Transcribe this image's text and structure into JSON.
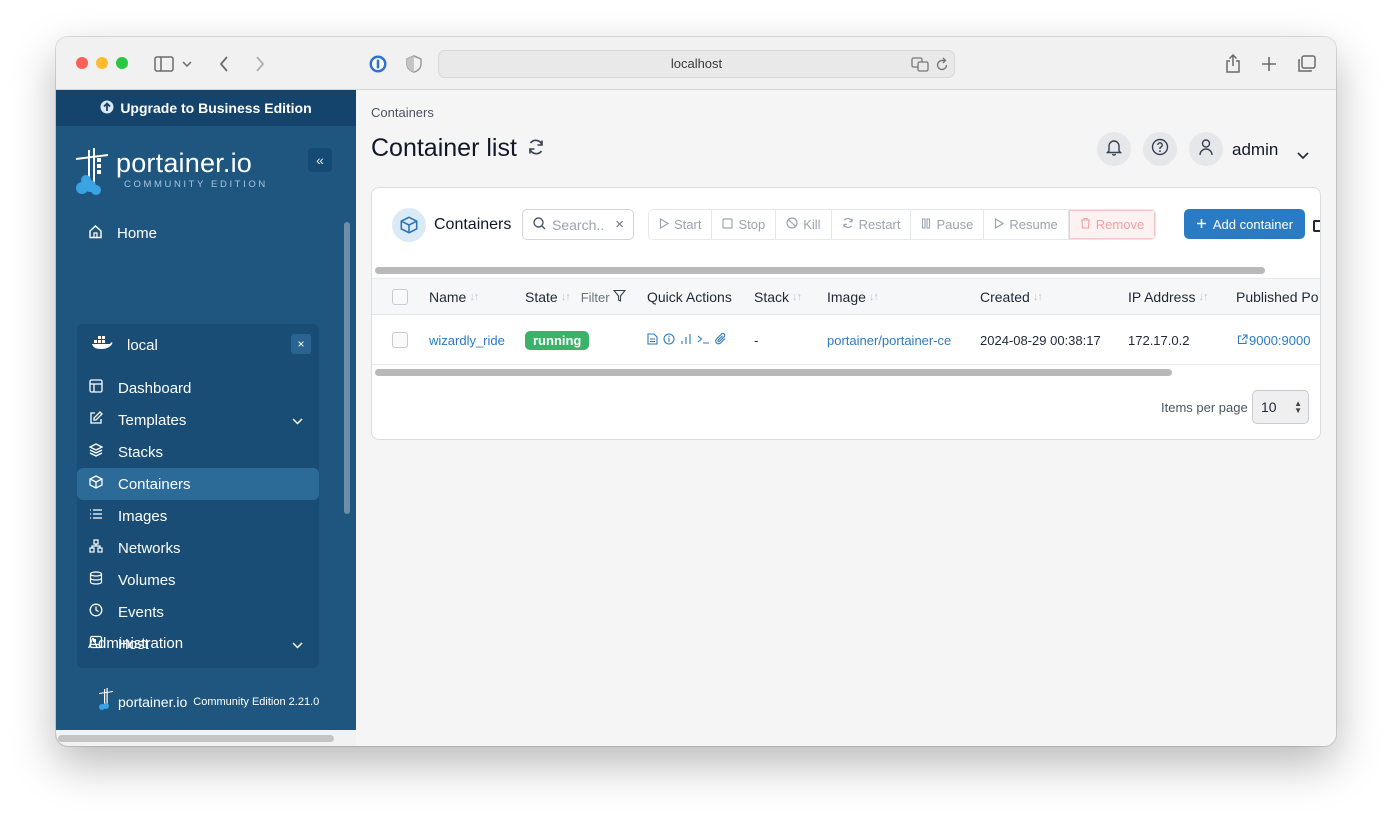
{
  "browser": {
    "url": "localhost"
  },
  "sidebar": {
    "upgrade_label": "Upgrade to Business Edition",
    "logo_word": "portainer.io",
    "logo_sub": "COMMUNITY EDITION",
    "collapse_label": "«",
    "home_label": "Home",
    "environment": {
      "name": "local",
      "close_label": "×",
      "items": [
        {
          "label": "Dashboard",
          "icon": "dashboard-icon"
        },
        {
          "label": "Templates",
          "icon": "edit-icon"
        },
        {
          "label": "Stacks",
          "icon": "layers-icon"
        },
        {
          "label": "Containers",
          "icon": "box-icon"
        },
        {
          "label": "Images",
          "icon": "list-icon"
        },
        {
          "label": "Networks",
          "icon": "network-icon"
        },
        {
          "label": "Volumes",
          "icon": "database-icon"
        },
        {
          "label": "Events",
          "icon": "clock-icon"
        },
        {
          "label": "Host",
          "icon": "host-icon"
        }
      ]
    },
    "administration_label": "Administration",
    "footer": {
      "brand": "portainer.io",
      "edition": "Community Edition 2.21.0"
    }
  },
  "header": {
    "breadcrumb": "Containers",
    "title": "Container list",
    "user": "admin"
  },
  "containers_card": {
    "title": "Containers",
    "search_placeholder": "Search..",
    "actions": {
      "start": "Start",
      "stop": "Stop",
      "kill": "Kill",
      "restart": "Restart",
      "pause": "Pause",
      "resume": "Resume",
      "remove": "Remove",
      "add": "Add container"
    },
    "columns": {
      "name": "Name",
      "state": "State",
      "filter": "Filter",
      "quick_actions": "Quick Actions",
      "stack": "Stack",
      "image": "Image",
      "created": "Created",
      "ip": "IP Address",
      "published": "Published Po"
    },
    "rows": [
      {
        "name": "wizardly_ride",
        "state": "running",
        "stack": "-",
        "image": "portainer/portainer-ce",
        "created": "2024-08-29 00:38:17",
        "ip": "172.17.0.2",
        "published": "9000:9000"
      }
    ],
    "items_per_page_label": "Items per page",
    "items_per_page_value": "10"
  },
  "colors": {
    "sidebar_bg": "#1e5680",
    "upgrade_bg": "#14436b",
    "accent": "#2b7bc4",
    "running": "#3bb26a"
  }
}
